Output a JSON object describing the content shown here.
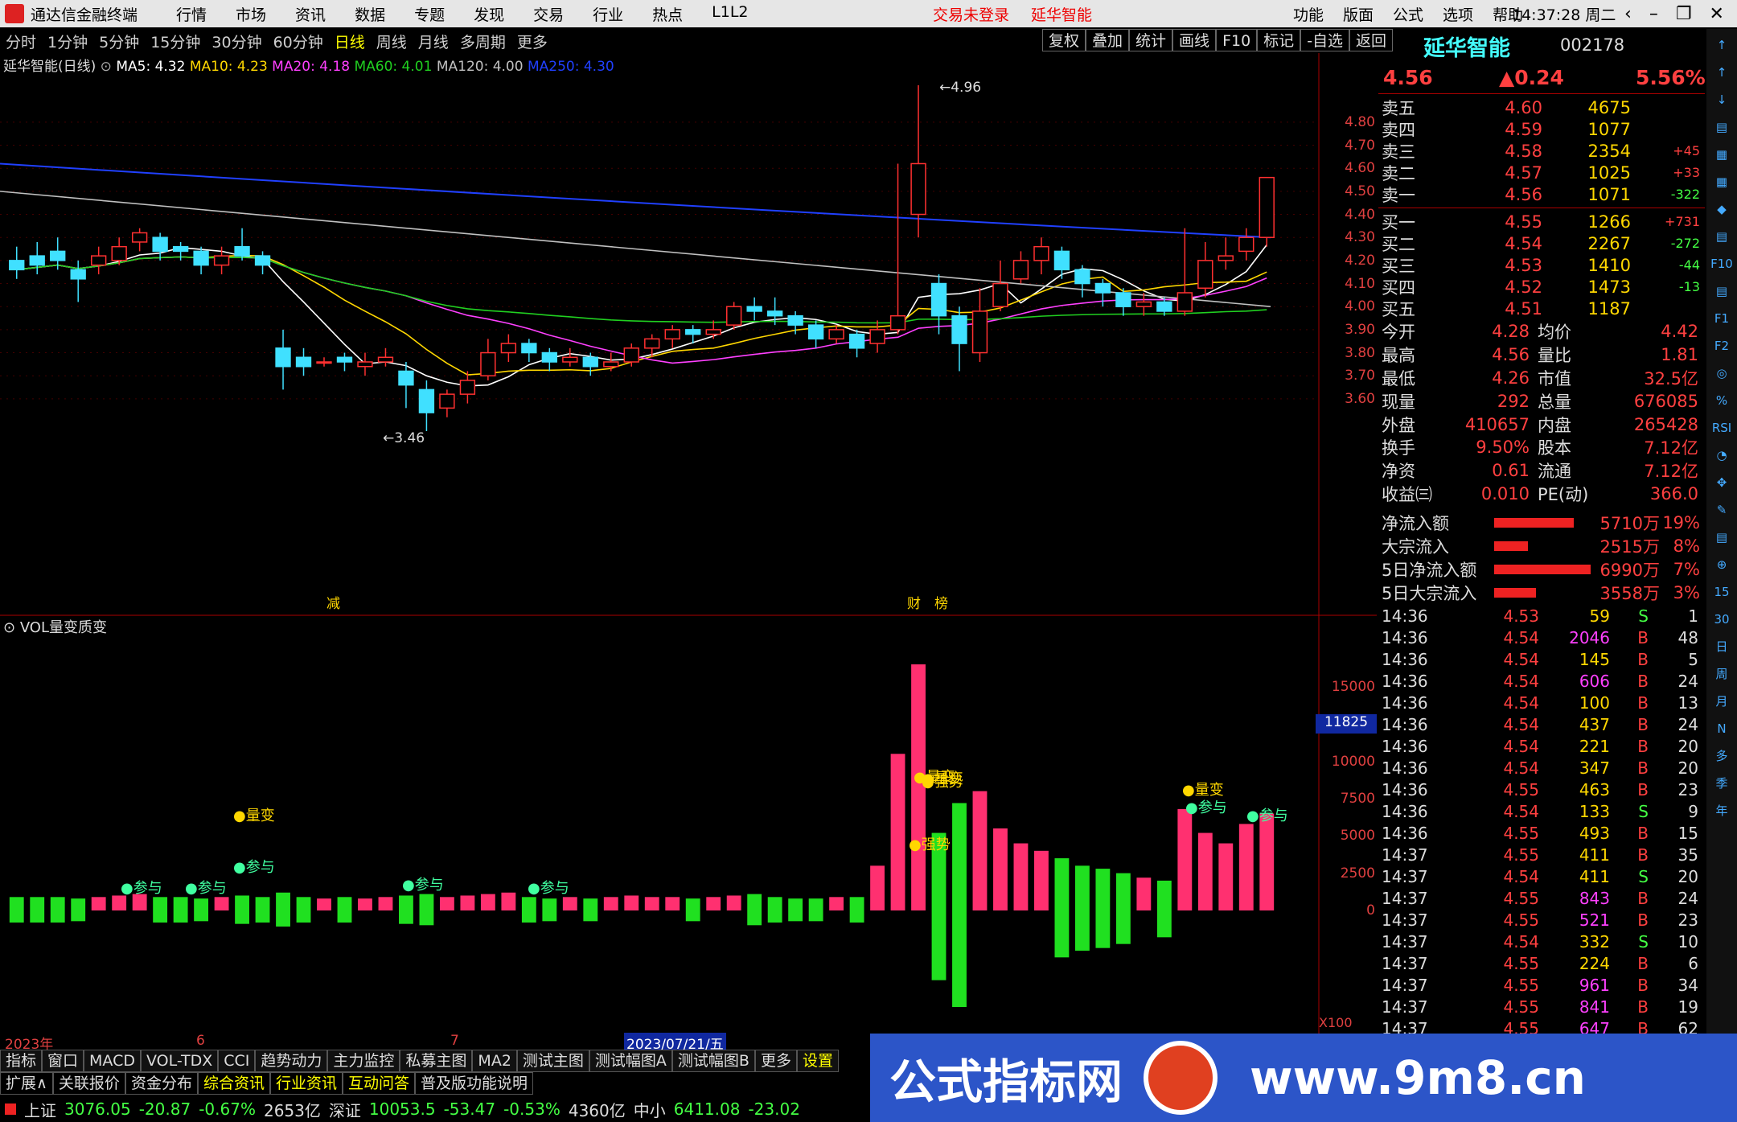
{
  "app": {
    "title": "通达信金融终端",
    "menus": [
      "行情",
      "市场",
      "资讯",
      "数据",
      "专题",
      "发现",
      "交易",
      "行业",
      "热点",
      "L1L2"
    ],
    "alert1": "交易未登录",
    "alert2": "延华智能",
    "rmenus": [
      "功能",
      "版面",
      "公式",
      "选项",
      "帮助"
    ],
    "time": "14:37:28",
    "weekday": "周二"
  },
  "toolbar": {
    "periods": [
      "分时",
      "1分钟",
      "5分钟",
      "15分钟",
      "30分钟",
      "60分钟",
      "日线",
      "周线",
      "月线",
      "多周期",
      "更多"
    ],
    "active": "日线",
    "tools": [
      "复权",
      "叠加",
      "统计",
      "画线",
      "F10",
      "标记",
      "-自选",
      "返回"
    ]
  },
  "legend": {
    "name": "延华智能(日线)",
    "ma5": "MA5: 4.32",
    "ma10": "MA10: 4.23",
    "ma20": "MA20: 4.18",
    "ma60": "MA60: 4.01",
    "ma120": "MA120: 4.00",
    "ma250": "MA250: 4.30"
  },
  "price_axis": [
    "4.80",
    "4.70",
    "4.60",
    "4.50",
    "4.40",
    "4.30",
    "4.20",
    "4.10",
    "4.00",
    "3.90",
    "3.80",
    "3.70",
    "3.60"
  ],
  "annotations": {
    "high": "4.96",
    "low": "3.46",
    "jian": "减",
    "dui": "财",
    "lv": "榜"
  },
  "vol": {
    "title": "VOL量变质变",
    "axis": [
      "15000",
      "12500",
      "10000",
      "7500",
      "5000",
      "2500",
      "0"
    ],
    "cur": "11825",
    "x100": "X100",
    "labels": [
      "量变",
      "参与",
      "参与",
      "参与",
      "参与",
      "参与",
      "强势",
      "量变",
      "强势",
      "量变",
      "参与",
      "参与",
      "量变"
    ]
  },
  "dates": {
    "y": "2023年",
    "m6": "6",
    "m7": "7",
    "cur": "2023/07/21/五"
  },
  "stock": {
    "name": "延华智能",
    "code": "002178",
    "price": "4.56",
    "chg": "▲0.24",
    "pct": "5.56%"
  },
  "sell": [
    {
      "l": "卖五",
      "p": "4.60",
      "v": "4675",
      "d": ""
    },
    {
      "l": "卖四",
      "p": "4.59",
      "v": "1077",
      "d": ""
    },
    {
      "l": "卖三",
      "p": "4.58",
      "v": "2354",
      "d": "+45"
    },
    {
      "l": "卖二",
      "p": "4.57",
      "v": "1025",
      "d": "+33"
    },
    {
      "l": "卖一",
      "p": "4.56",
      "v": "1071",
      "d": "-322"
    }
  ],
  "buy": [
    {
      "l": "买一",
      "p": "4.55",
      "v": "1266",
      "d": "+731"
    },
    {
      "l": "买二",
      "p": "4.54",
      "v": "2267",
      "d": "-272"
    },
    {
      "l": "买三",
      "p": "4.53",
      "v": "1410",
      "d": "-44"
    },
    {
      "l": "买四",
      "p": "4.52",
      "v": "1473",
      "d": "-13"
    },
    {
      "l": "买五",
      "p": "4.51",
      "v": "1187",
      "d": ""
    }
  ],
  "stats": [
    [
      "今开",
      "4.28",
      "均价",
      "4.42"
    ],
    [
      "最高",
      "4.56",
      "量比",
      "1.81"
    ],
    [
      "最低",
      "4.26",
      "市值",
      "32.5亿"
    ],
    [
      "现量",
      "292",
      "总量",
      "676085"
    ],
    [
      "外盘",
      "410657",
      "内盘",
      "265428"
    ]
  ],
  "stats2": [
    [
      "换手",
      "9.50%",
      "股本",
      "7.12亿"
    ],
    [
      "净资",
      "0.61",
      "流通",
      "7.12亿"
    ],
    [
      "收益㈢",
      "0.010",
      "PE(动)",
      "366.0"
    ]
  ],
  "flows": [
    {
      "l": "净流入额",
      "v": "5710万",
      "p": "19%",
      "w": 0.19
    },
    {
      "l": "大宗流入",
      "v": "2515万",
      "p": "8%",
      "w": 0.08
    },
    {
      "l": "5日净流入额",
      "v": "6990万",
      "p": "7%",
      "w": 0.23
    },
    {
      "l": "5日大宗流入",
      "v": "3558万",
      "p": "3%",
      "w": 0.1
    }
  ],
  "ticks": [
    [
      "14:36",
      "4.53",
      "59",
      "S",
      "1"
    ],
    [
      "14:36",
      "4.54",
      "2046",
      "B",
      "48"
    ],
    [
      "14:36",
      "4.54",
      "145",
      "B",
      "5"
    ],
    [
      "14:36",
      "4.54",
      "606",
      "B",
      "24"
    ],
    [
      "14:36",
      "4.54",
      "100",
      "B",
      "13"
    ],
    [
      "14:36",
      "4.54",
      "437",
      "B",
      "24"
    ],
    [
      "14:36",
      "4.54",
      "221",
      "B",
      "20"
    ],
    [
      "14:36",
      "4.54",
      "347",
      "B",
      "20"
    ],
    [
      "14:36",
      "4.55",
      "463",
      "B",
      "23"
    ],
    [
      "14:36",
      "4.54",
      "133",
      "S",
      "9"
    ],
    [
      "14:36",
      "4.55",
      "493",
      "B",
      "15"
    ],
    [
      "14:37",
      "4.55",
      "411",
      "B",
      "35"
    ],
    [
      "14:37",
      "4.54",
      "411",
      "S",
      "20"
    ],
    [
      "14:37",
      "4.55",
      "843",
      "B",
      "24"
    ],
    [
      "14:37",
      "4.55",
      "521",
      "B",
      "23"
    ],
    [
      "14:37",
      "4.54",
      "332",
      "S",
      "10"
    ],
    [
      "14:37",
      "4.55",
      "224",
      "B",
      "6"
    ],
    [
      "14:37",
      "4.55",
      "961",
      "B",
      "34"
    ],
    [
      "14:37",
      "4.55",
      "841",
      "B",
      "19"
    ],
    [
      "14:37",
      "4.55",
      "647",
      "B",
      "62"
    ]
  ],
  "rtools": [
    "↑",
    "↑",
    "↓",
    "▤",
    "▦",
    "▦",
    "◆",
    "▤",
    "F10",
    "▤",
    "F1",
    "F2",
    "◎",
    "%",
    "RSI",
    "◔",
    "✥",
    "✎",
    "▤",
    "⊕",
    "15",
    "30",
    "日",
    "周",
    "月",
    "N",
    "多",
    "季",
    "年"
  ],
  "btabs": [
    "指标",
    "窗口",
    "MACD",
    "VOL-TDX",
    "CCI",
    "趋势动力",
    "主力监控",
    "私募主图",
    "MA2",
    "测试主图",
    "测试幅图A",
    "测试幅图B",
    "更多",
    "设置"
  ],
  "btabs2": [
    "扩展∧",
    "关联报价",
    "资金分布",
    "综合资讯",
    "行业资讯",
    "互动问答",
    "普及版功能说明"
  ],
  "status": {
    "sh": "上证",
    "shv": "3076.05",
    "shc": "-20.87",
    "shp": "-0.67%",
    "sha": "2653亿",
    "sz": "深证",
    "szv": "10053.5",
    "szc": "-53.47",
    "szp": "-0.53%",
    "sza": "4360亿",
    "zx": "中小",
    "zxv": "6411.08",
    "zxc": "-23.02"
  },
  "banner": {
    "t1": "公式指标网",
    "t2": "www.9m8.cn"
  },
  "chart_data": {
    "type": "candlestick",
    "ma_labels": [
      "MA5",
      "MA10",
      "MA20",
      "MA60",
      "MA120",
      "MA250"
    ],
    "colors": {
      "up": "#ff3030",
      "down": "#40e0ff",
      "ma5": "#ffffff",
      "ma10": "#ffd700",
      "ma20": "#ff40ff",
      "ma60": "#20d020",
      "ma120": "#c0c0c0",
      "ma250": "#2040ff"
    },
    "candles": [
      [
        4.2,
        4.16,
        4.26,
        4.12
      ],
      [
        4.22,
        4.18,
        4.28,
        4.14
      ],
      [
        4.24,
        4.2,
        4.3,
        4.16
      ],
      [
        4.16,
        4.12,
        4.2,
        4.02
      ],
      [
        4.18,
        4.22,
        4.26,
        4.14
      ],
      [
        4.2,
        4.26,
        4.3,
        4.18
      ],
      [
        4.28,
        4.32,
        4.34,
        4.24
      ],
      [
        4.3,
        4.24,
        4.32,
        4.2
      ],
      [
        4.26,
        4.24,
        4.28,
        4.2
      ],
      [
        4.24,
        4.18,
        4.26,
        4.14
      ],
      [
        4.18,
        4.22,
        4.26,
        4.14
      ],
      [
        4.26,
        4.22,
        4.34,
        4.2
      ],
      [
        4.22,
        4.18,
        4.24,
        4.14
      ],
      [
        3.82,
        3.74,
        3.9,
        3.64
      ],
      [
        3.78,
        3.74,
        3.82,
        3.7
      ],
      [
        3.76,
        3.76,
        3.78,
        3.74
      ],
      [
        3.78,
        3.76,
        3.8,
        3.72
      ],
      [
        3.74,
        3.76,
        3.8,
        3.7
      ],
      [
        3.76,
        3.78,
        3.82,
        3.74
      ],
      [
        3.72,
        3.66,
        3.76,
        3.56
      ],
      [
        3.64,
        3.54,
        3.68,
        3.46
      ],
      [
        3.56,
        3.62,
        3.64,
        3.52
      ],
      [
        3.62,
        3.68,
        3.72,
        3.58
      ],
      [
        3.7,
        3.8,
        3.86,
        3.68
      ],
      [
        3.8,
        3.84,
        3.88,
        3.76
      ],
      [
        3.84,
        3.8,
        3.86,
        3.76
      ],
      [
        3.8,
        3.76,
        3.82,
        3.72
      ],
      [
        3.76,
        3.78,
        3.82,
        3.74
      ],
      [
        3.78,
        3.74,
        3.8,
        3.7
      ],
      [
        3.74,
        3.76,
        3.8,
        3.72
      ],
      [
        3.76,
        3.82,
        3.84,
        3.74
      ],
      [
        3.82,
        3.86,
        3.88,
        3.78
      ],
      [
        3.86,
        3.9,
        3.92,
        3.82
      ],
      [
        3.9,
        3.88,
        3.92,
        3.84
      ],
      [
        3.88,
        3.9,
        3.94,
        3.86
      ],
      [
        3.92,
        4.0,
        4.02,
        3.9
      ],
      [
        4.0,
        3.98,
        4.04,
        3.94
      ],
      [
        3.98,
        3.96,
        4.04,
        3.92
      ],
      [
        3.96,
        3.92,
        3.98,
        3.88
      ],
      [
        3.92,
        3.86,
        3.94,
        3.82
      ],
      [
        3.86,
        3.9,
        3.92,
        3.84
      ],
      [
        3.88,
        3.82,
        3.9,
        3.78
      ],
      [
        3.84,
        3.9,
        3.94,
        3.8
      ],
      [
        3.9,
        3.96,
        4.62,
        3.88
      ],
      [
        4.4,
        4.62,
        4.96,
        4.3
      ],
      [
        4.1,
        3.96,
        4.14,
        3.88
      ],
      [
        3.96,
        3.84,
        4.0,
        3.72
      ],
      [
        3.8,
        3.98,
        4.08,
        3.76
      ],
      [
        4.0,
        4.1,
        4.2,
        3.98
      ],
      [
        4.12,
        4.2,
        4.24,
        4.1
      ],
      [
        4.2,
        4.26,
        4.3,
        4.14
      ],
      [
        4.24,
        4.16,
        4.26,
        4.12
      ],
      [
        4.16,
        4.1,
        4.18,
        4.04
      ],
      [
        4.1,
        4.06,
        4.12,
        4.0
      ],
      [
        4.06,
        4.0,
        4.08,
        3.96
      ],
      [
        4.0,
        4.02,
        4.06,
        3.96
      ],
      [
        4.02,
        3.98,
        4.04,
        3.96
      ],
      [
        3.98,
        4.06,
        4.34,
        3.96
      ],
      [
        4.08,
        4.2,
        4.28,
        4.04
      ],
      [
        4.2,
        4.22,
        4.3,
        4.16
      ],
      [
        4.24,
        4.3,
        4.34,
        4.2
      ],
      [
        4.3,
        4.56,
        4.56,
        4.26
      ]
    ]
  }
}
